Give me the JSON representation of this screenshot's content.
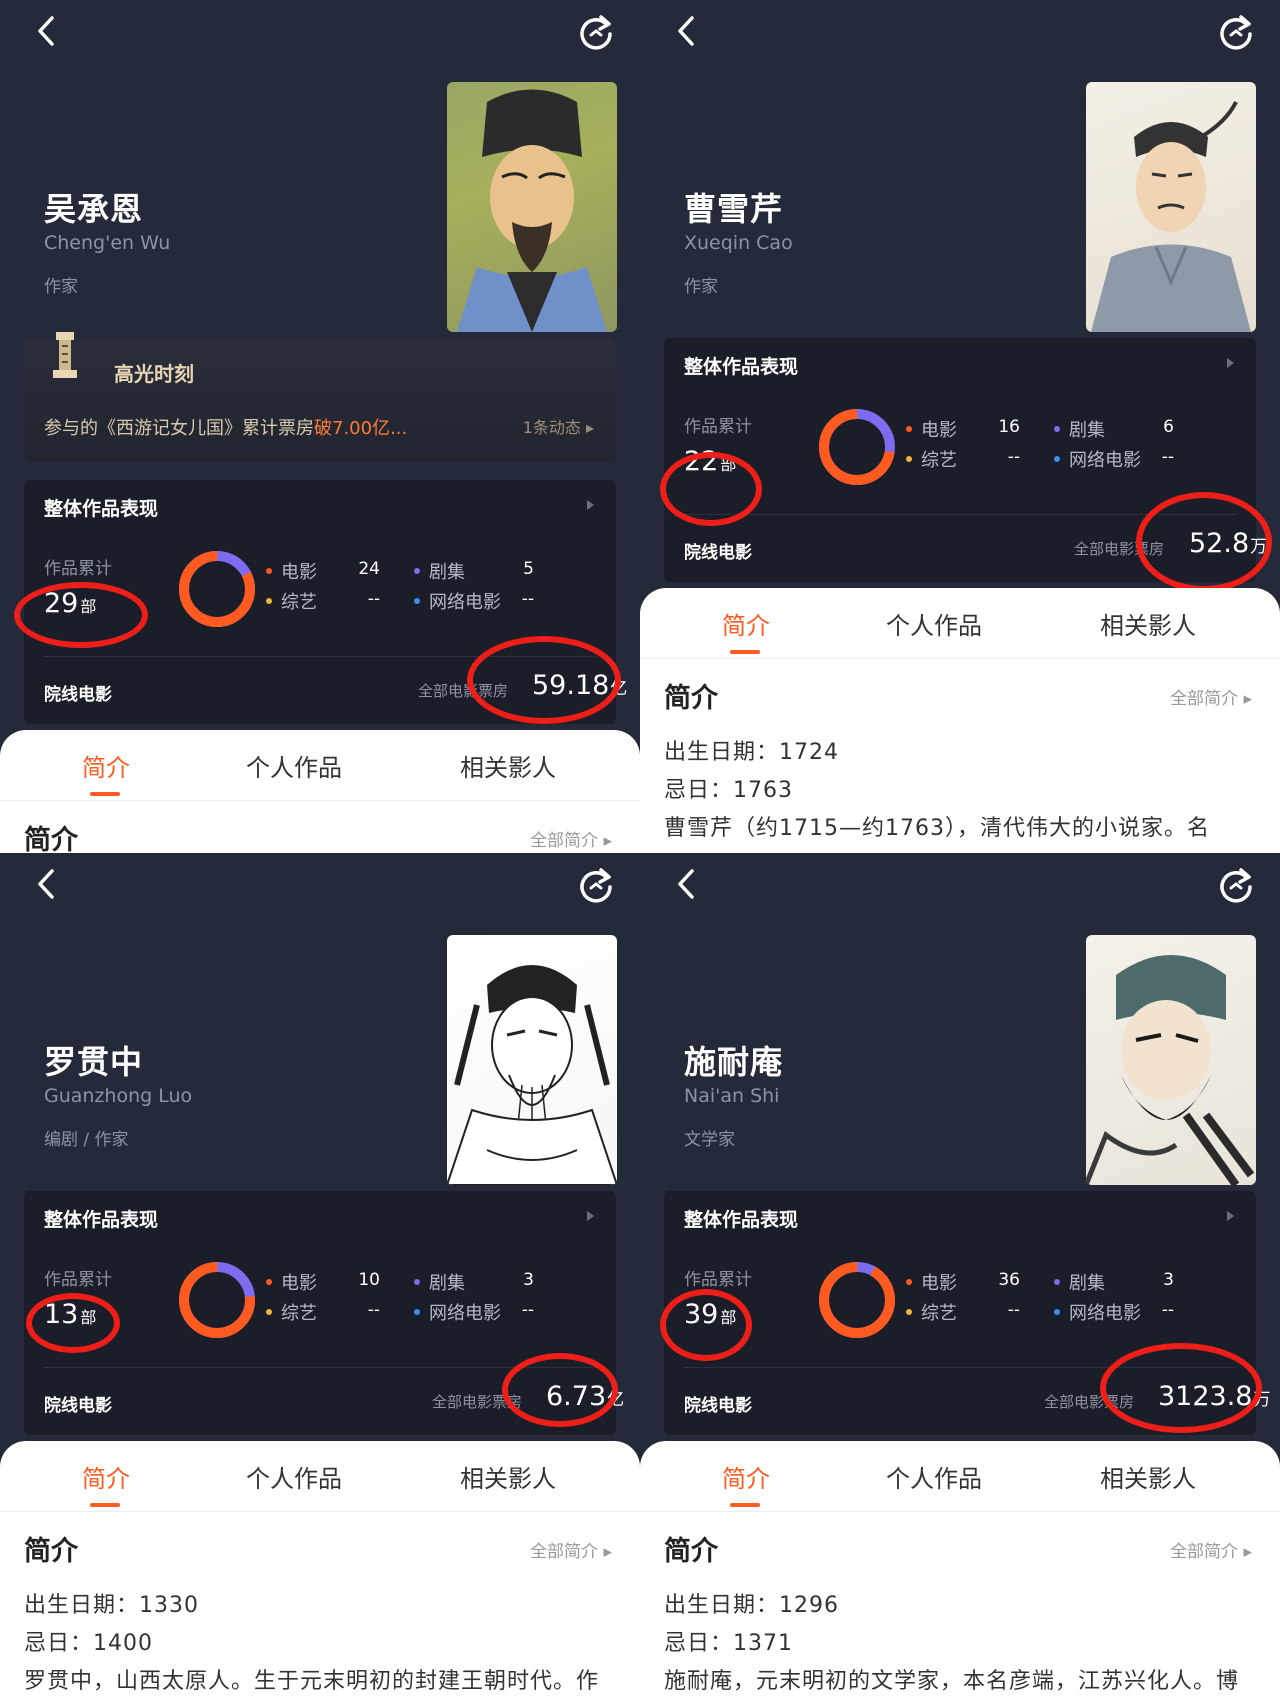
{
  "common": {
    "perf_title": "整体作品表现",
    "cumulative_label": "作品累计",
    "count_unit": "部",
    "legend": {
      "movie": "电影",
      "series": "剧集",
      "variety": "综艺",
      "web_movie": "网络电影"
    },
    "cinema_label": "院线电影",
    "box_label": "全部电影票房",
    "tabs": [
      "简介",
      "个人作品",
      "相关影人"
    ],
    "intro_title": "简介",
    "intro_all": "全部简介 ▸",
    "birth_label": "出生日期：",
    "death_label": "忌日：",
    "highlight": {
      "title": "高光时刻",
      "text_prefix": "参与的《西游记女儿国》累计票房",
      "text_hot": "破7.00亿...",
      "more": "1条动态 ▸"
    }
  },
  "colors": {
    "movie": "#ff5a1f",
    "series": "#7b6cf0",
    "variety": "#f5b23a",
    "web_movie": "#3f8ef5",
    "ring": "#ee1e19",
    "accent": "#ff5a1f"
  },
  "panels": [
    {
      "name": "吴承恩",
      "name_en": "Cheng'en Wu",
      "role": "作家",
      "count": "29",
      "movie": "24",
      "series": "5",
      "variety": "--",
      "web_movie": "--",
      "box_value": "59.18",
      "box_unit": "亿",
      "movie_share": 0.828,
      "has_highlight": true,
      "birth": "",
      "death": "",
      "bio": ""
    },
    {
      "name": "曹雪芹",
      "name_en": "Xueqin Cao",
      "role": "作家",
      "count": "22",
      "movie": "16",
      "series": "6",
      "variety": "--",
      "web_movie": "--",
      "box_value": "52.8",
      "box_unit": "万",
      "movie_share": 0.727,
      "has_highlight": false,
      "birth": "1724",
      "death": "1763",
      "bio": "曹雪芹（约1715—约1763），清代伟大的小说家。名"
    },
    {
      "name": "罗贯中",
      "name_en": "Guanzhong Luo",
      "role": "编剧 / 作家",
      "count": "13",
      "movie": "10",
      "series": "3",
      "variety": "--",
      "web_movie": "--",
      "box_value": "6.73",
      "box_unit": "亿",
      "movie_share": 0.769,
      "has_highlight": false,
      "birth": "1330",
      "death": "1400",
      "bio": "罗贯中，山西太原人。生于元末明初的封建王朝时代。作"
    },
    {
      "name": "施耐庵",
      "name_en": "Nai'an Shi",
      "role": "文学家",
      "count": "39",
      "movie": "36",
      "series": "3",
      "variety": "--",
      "web_movie": "--",
      "box_value": "3123.8",
      "box_unit": "万",
      "movie_share": 0.923,
      "has_highlight": false,
      "birth": "1296",
      "death": "1371",
      "bio": "施耐庵，元末明初的文学家，本名彦端，江苏兴化人。博"
    }
  ]
}
